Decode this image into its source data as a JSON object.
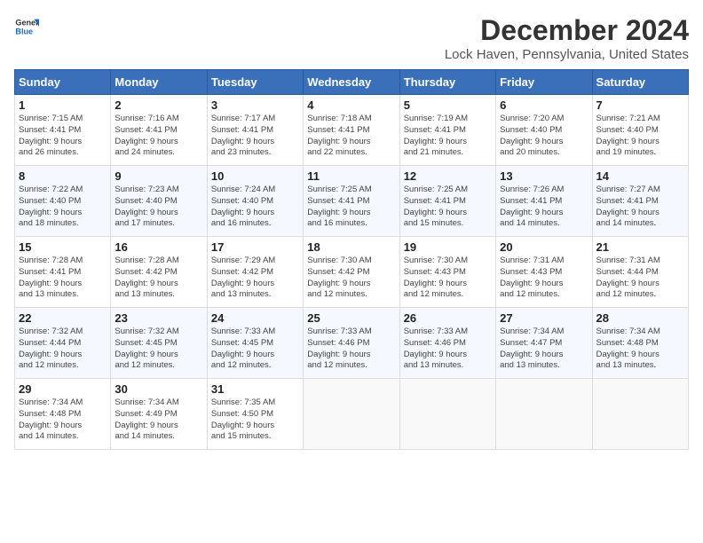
{
  "header": {
    "logo_general": "General",
    "logo_blue": "Blue",
    "title": "December 2024",
    "subtitle": "Lock Haven, Pennsylvania, United States"
  },
  "days_of_week": [
    "Sunday",
    "Monday",
    "Tuesday",
    "Wednesday",
    "Thursday",
    "Friday",
    "Saturday"
  ],
  "weeks": [
    [
      {
        "day": "1",
        "info": "Sunrise: 7:15 AM\nSunset: 4:41 PM\nDaylight: 9 hours\nand 26 minutes."
      },
      {
        "day": "2",
        "info": "Sunrise: 7:16 AM\nSunset: 4:41 PM\nDaylight: 9 hours\nand 24 minutes."
      },
      {
        "day": "3",
        "info": "Sunrise: 7:17 AM\nSunset: 4:41 PM\nDaylight: 9 hours\nand 23 minutes."
      },
      {
        "day": "4",
        "info": "Sunrise: 7:18 AM\nSunset: 4:41 PM\nDaylight: 9 hours\nand 22 minutes."
      },
      {
        "day": "5",
        "info": "Sunrise: 7:19 AM\nSunset: 4:41 PM\nDaylight: 9 hours\nand 21 minutes."
      },
      {
        "day": "6",
        "info": "Sunrise: 7:20 AM\nSunset: 4:40 PM\nDaylight: 9 hours\nand 20 minutes."
      },
      {
        "day": "7",
        "info": "Sunrise: 7:21 AM\nSunset: 4:40 PM\nDaylight: 9 hours\nand 19 minutes."
      }
    ],
    [
      {
        "day": "8",
        "info": "Sunrise: 7:22 AM\nSunset: 4:40 PM\nDaylight: 9 hours\nand 18 minutes."
      },
      {
        "day": "9",
        "info": "Sunrise: 7:23 AM\nSunset: 4:40 PM\nDaylight: 9 hours\nand 17 minutes."
      },
      {
        "day": "10",
        "info": "Sunrise: 7:24 AM\nSunset: 4:40 PM\nDaylight: 9 hours\nand 16 minutes."
      },
      {
        "day": "11",
        "info": "Sunrise: 7:25 AM\nSunset: 4:41 PM\nDaylight: 9 hours\nand 16 minutes."
      },
      {
        "day": "12",
        "info": "Sunrise: 7:25 AM\nSunset: 4:41 PM\nDaylight: 9 hours\nand 15 minutes."
      },
      {
        "day": "13",
        "info": "Sunrise: 7:26 AM\nSunset: 4:41 PM\nDaylight: 9 hours\nand 14 minutes."
      },
      {
        "day": "14",
        "info": "Sunrise: 7:27 AM\nSunset: 4:41 PM\nDaylight: 9 hours\nand 14 minutes."
      }
    ],
    [
      {
        "day": "15",
        "info": "Sunrise: 7:28 AM\nSunset: 4:41 PM\nDaylight: 9 hours\nand 13 minutes."
      },
      {
        "day": "16",
        "info": "Sunrise: 7:28 AM\nSunset: 4:42 PM\nDaylight: 9 hours\nand 13 minutes."
      },
      {
        "day": "17",
        "info": "Sunrise: 7:29 AM\nSunset: 4:42 PM\nDaylight: 9 hours\nand 13 minutes."
      },
      {
        "day": "18",
        "info": "Sunrise: 7:30 AM\nSunset: 4:42 PM\nDaylight: 9 hours\nand 12 minutes."
      },
      {
        "day": "19",
        "info": "Sunrise: 7:30 AM\nSunset: 4:43 PM\nDaylight: 9 hours\nand 12 minutes."
      },
      {
        "day": "20",
        "info": "Sunrise: 7:31 AM\nSunset: 4:43 PM\nDaylight: 9 hours\nand 12 minutes."
      },
      {
        "day": "21",
        "info": "Sunrise: 7:31 AM\nSunset: 4:44 PM\nDaylight: 9 hours\nand 12 minutes."
      }
    ],
    [
      {
        "day": "22",
        "info": "Sunrise: 7:32 AM\nSunset: 4:44 PM\nDaylight: 9 hours\nand 12 minutes."
      },
      {
        "day": "23",
        "info": "Sunrise: 7:32 AM\nSunset: 4:45 PM\nDaylight: 9 hours\nand 12 minutes."
      },
      {
        "day": "24",
        "info": "Sunrise: 7:33 AM\nSunset: 4:45 PM\nDaylight: 9 hours\nand 12 minutes."
      },
      {
        "day": "25",
        "info": "Sunrise: 7:33 AM\nSunset: 4:46 PM\nDaylight: 9 hours\nand 12 minutes."
      },
      {
        "day": "26",
        "info": "Sunrise: 7:33 AM\nSunset: 4:46 PM\nDaylight: 9 hours\nand 13 minutes."
      },
      {
        "day": "27",
        "info": "Sunrise: 7:34 AM\nSunset: 4:47 PM\nDaylight: 9 hours\nand 13 minutes."
      },
      {
        "day": "28",
        "info": "Sunrise: 7:34 AM\nSunset: 4:48 PM\nDaylight: 9 hours\nand 13 minutes."
      }
    ],
    [
      {
        "day": "29",
        "info": "Sunrise: 7:34 AM\nSunset: 4:48 PM\nDaylight: 9 hours\nand 14 minutes."
      },
      {
        "day": "30",
        "info": "Sunrise: 7:34 AM\nSunset: 4:49 PM\nDaylight: 9 hours\nand 14 minutes."
      },
      {
        "day": "31",
        "info": "Sunrise: 7:35 AM\nSunset: 4:50 PM\nDaylight: 9 hours\nand 15 minutes."
      },
      {
        "day": "",
        "info": ""
      },
      {
        "day": "",
        "info": ""
      },
      {
        "day": "",
        "info": ""
      },
      {
        "day": "",
        "info": ""
      }
    ]
  ]
}
